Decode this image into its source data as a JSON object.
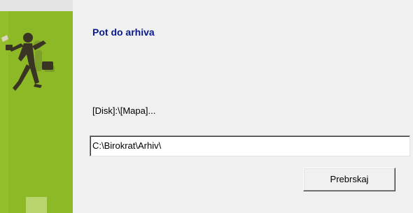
{
  "wizard": {
    "title": "Pot do arhiva",
    "path_format_label": "[Disk]:\\[Mapa]...",
    "archive_path_value": "C:\\Birokrat\\Arhiv\\",
    "browse_button_label": "Prebrskaj"
  },
  "colors": {
    "banner_green": "#8eb927",
    "title_blue": "#0a1a8a",
    "dialog_background": "#f0f0f0"
  },
  "icons": {
    "banner_figure": "running-businessman-figure"
  }
}
